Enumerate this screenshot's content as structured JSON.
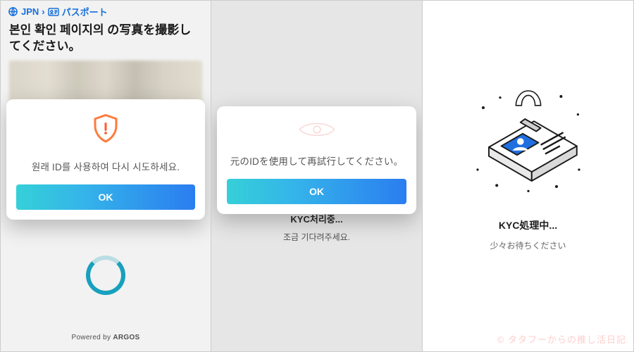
{
  "panel1": {
    "breadcrumb": {
      "country": "JPN",
      "doc_type": "パスポート"
    },
    "title": "본인 확인 페이지의 の写真を撮影してください。",
    "modal": {
      "message": "원래 ID를 사용하여 다시 시도하세요.",
      "ok": "OK"
    },
    "powered_prefix": "Powered by ",
    "powered_brand": "ARGOS"
  },
  "panel2": {
    "modal": {
      "message": "元のIDを使用して再試行してください。",
      "ok": "OK"
    },
    "behind": {
      "line1": "KYC처리중...",
      "line2": "조금 기다려주세요."
    }
  },
  "panel3": {
    "title": "KYC処理中...",
    "subtitle": "少々お待ちください"
  },
  "watermark": "© タタフーからの推し活日記"
}
